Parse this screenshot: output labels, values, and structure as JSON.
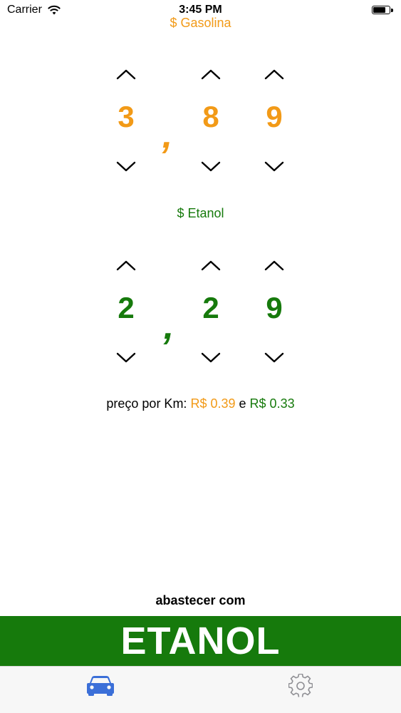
{
  "status_bar": {
    "carrier": "Carrier",
    "time": "3:45 PM"
  },
  "colors": {
    "gasoline": "#f29a17",
    "ethanol": "#167a0c",
    "tab_active": "#3b6fd8",
    "tab_inactive": "#8e8e93"
  },
  "gasoline": {
    "label": "$ Gasolina",
    "digits": [
      "3",
      "8",
      "9"
    ],
    "separator": ","
  },
  "ethanol": {
    "label": "$ Etanol",
    "digits": [
      "2",
      "2",
      "9"
    ],
    "separator": ","
  },
  "price_per_km": {
    "prefix": "preço por Km:",
    "gasoline_value": "R$ 0.39",
    "connector": "e",
    "ethanol_value": "R$ 0.33"
  },
  "result": {
    "caption": "abastecer com",
    "fuel": "ETANOL"
  },
  "tab_bar": {
    "items": [
      {
        "icon": "car-icon",
        "active": true
      },
      {
        "icon": "gear-icon",
        "active": false
      }
    ]
  }
}
